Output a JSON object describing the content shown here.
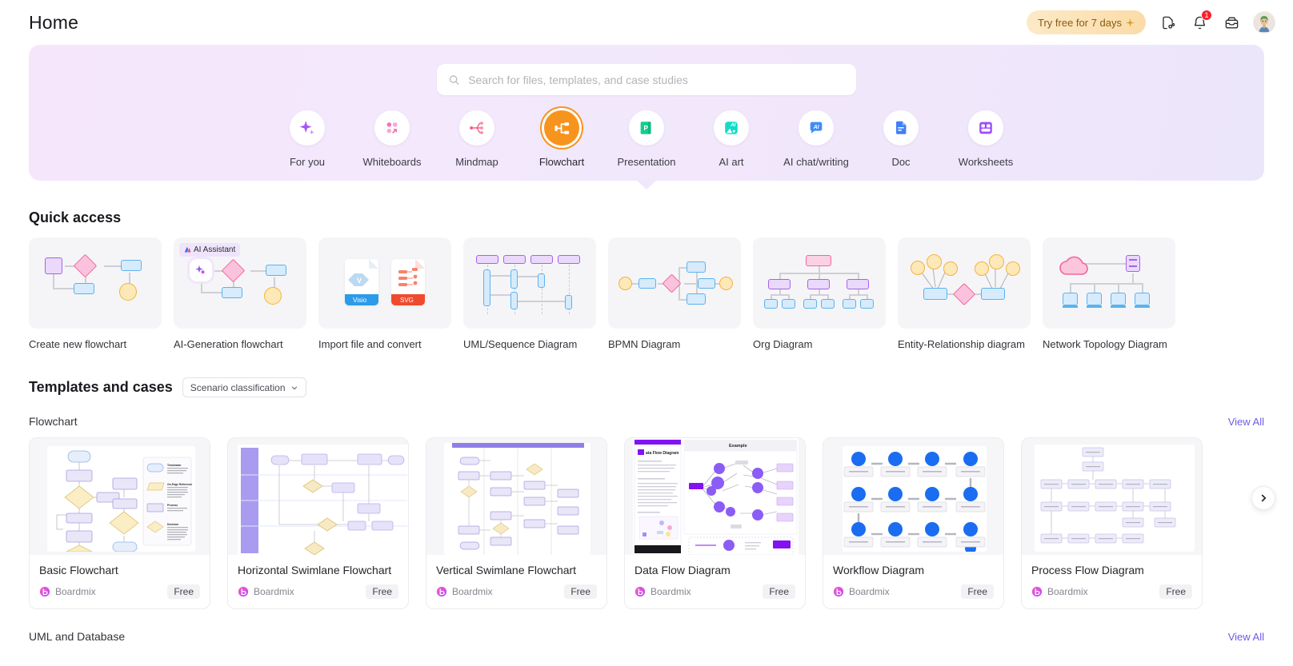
{
  "header": {
    "title": "Home",
    "trial_label": "Try free for 7 days",
    "trial_icon": "sparkle-icon",
    "icons": [
      {
        "name": "share-file-icon",
        "glyph": "file-link"
      },
      {
        "name": "notification-bell-icon",
        "glyph": "bell",
        "badge": "1"
      },
      {
        "name": "inbox-icon",
        "glyph": "inbox"
      },
      {
        "name": "user-avatar",
        "glyph": "avatar"
      }
    ]
  },
  "banner": {
    "search": {
      "placeholder": "Search for files, templates, and case studies",
      "value": "",
      "icon": "search-icon"
    },
    "categories": [
      {
        "label": "For you",
        "icon": "sparkle-icon",
        "active": false
      },
      {
        "label": "Whiteboards",
        "icon": "whiteboard-icon",
        "active": false
      },
      {
        "label": "Mindmap",
        "icon": "mindmap-icon",
        "active": false
      },
      {
        "label": "Flowchart",
        "icon": "flowchart-icon",
        "active": true
      },
      {
        "label": "Presentation",
        "icon": "slides-icon",
        "active": false
      },
      {
        "label": "AI art",
        "icon": "ai-art-icon",
        "active": false
      },
      {
        "label": "AI chat/writing",
        "icon": "ai-chat-icon",
        "active": false
      },
      {
        "label": "Doc",
        "icon": "doc-icon",
        "active": false
      },
      {
        "label": "Worksheets",
        "icon": "worksheets-icon",
        "active": false
      }
    ],
    "active_accent": "#f7941e"
  },
  "quick_access": {
    "heading": "Quick access",
    "items": [
      {
        "label": "Create new flowchart",
        "thumb": "flowchart-basic"
      },
      {
        "label": "AI-Generation flowchart",
        "thumb": "flowchart-ai",
        "chip": "AI Assistant"
      },
      {
        "label": "Import file and convert",
        "thumb": "import-files"
      },
      {
        "label": "UML/Sequence Diagram",
        "thumb": "uml-sequence"
      },
      {
        "label": "BPMN Diagram",
        "thumb": "bpmn"
      },
      {
        "label": "Org Diagram",
        "thumb": "org"
      },
      {
        "label": "Entity-Relationship diagram",
        "thumb": "er"
      },
      {
        "label": "Network Topology Diagram",
        "thumb": "network"
      }
    ]
  },
  "templates": {
    "heading": "Templates and cases",
    "filter": {
      "label": "Scenario classification",
      "icon": "chevron-down-icon"
    },
    "view_all_label": "View All",
    "next_icon": "chevron-right-icon",
    "sections": [
      {
        "name": "Flowchart",
        "cards": [
          {
            "name": "Basic Flowchart",
            "author": "Boardmix",
            "price": "Free",
            "thumb": "basic-flowchart"
          },
          {
            "name": "Horizontal Swimlane Flowchart",
            "author": "Boardmix",
            "price": "Free",
            "thumb": "h-swimlane"
          },
          {
            "name": "Vertical Swimlane Flowchart",
            "author": "Boardmix",
            "price": "Free",
            "thumb": "v-swimlane"
          },
          {
            "name": "Data Flow Diagram",
            "author": "Boardmix",
            "price": "Free",
            "thumb": "data-flow"
          },
          {
            "name": "Workflow Diagram",
            "author": "Boardmix",
            "price": "Free",
            "thumb": "workflow"
          },
          {
            "name": "Process Flow Diagram",
            "author": "Boardmix",
            "price": "Free",
            "thumb": "process-flow"
          }
        ]
      },
      {
        "name": "UML and Database",
        "cards": []
      }
    ]
  }
}
